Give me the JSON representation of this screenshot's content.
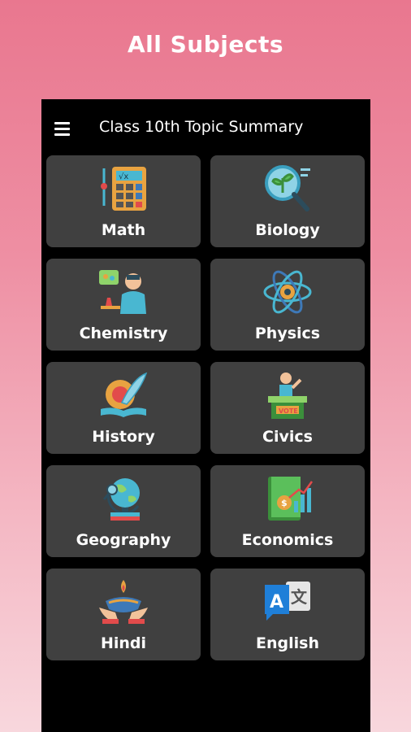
{
  "page_heading": "All Subjects",
  "app_bar": {
    "title": "Class 10th Topic Summary",
    "menu_icon": "hamburger-menu-icon"
  },
  "subjects": [
    {
      "label": "Math",
      "icon": "calculator-icon"
    },
    {
      "label": "Biology",
      "icon": "plant-magnifier-icon"
    },
    {
      "label": "Chemistry",
      "icon": "scientist-lab-icon"
    },
    {
      "label": "Physics",
      "icon": "atom-icon"
    },
    {
      "label": "History",
      "icon": "book-quill-icon"
    },
    {
      "label": "Civics",
      "icon": "vote-podium-icon"
    },
    {
      "label": "Geography",
      "icon": "globe-icon"
    },
    {
      "label": "Economics",
      "icon": "economics-book-icon"
    },
    {
      "label": "Hindi",
      "icon": "diya-icon"
    },
    {
      "label": "English",
      "icon": "translate-icon"
    }
  ],
  "colors": {
    "background_top": "#e9778f",
    "background_bottom": "#f8d7dd",
    "phone_background": "#000000",
    "card_background": "#404040",
    "text": "#ffffff"
  }
}
